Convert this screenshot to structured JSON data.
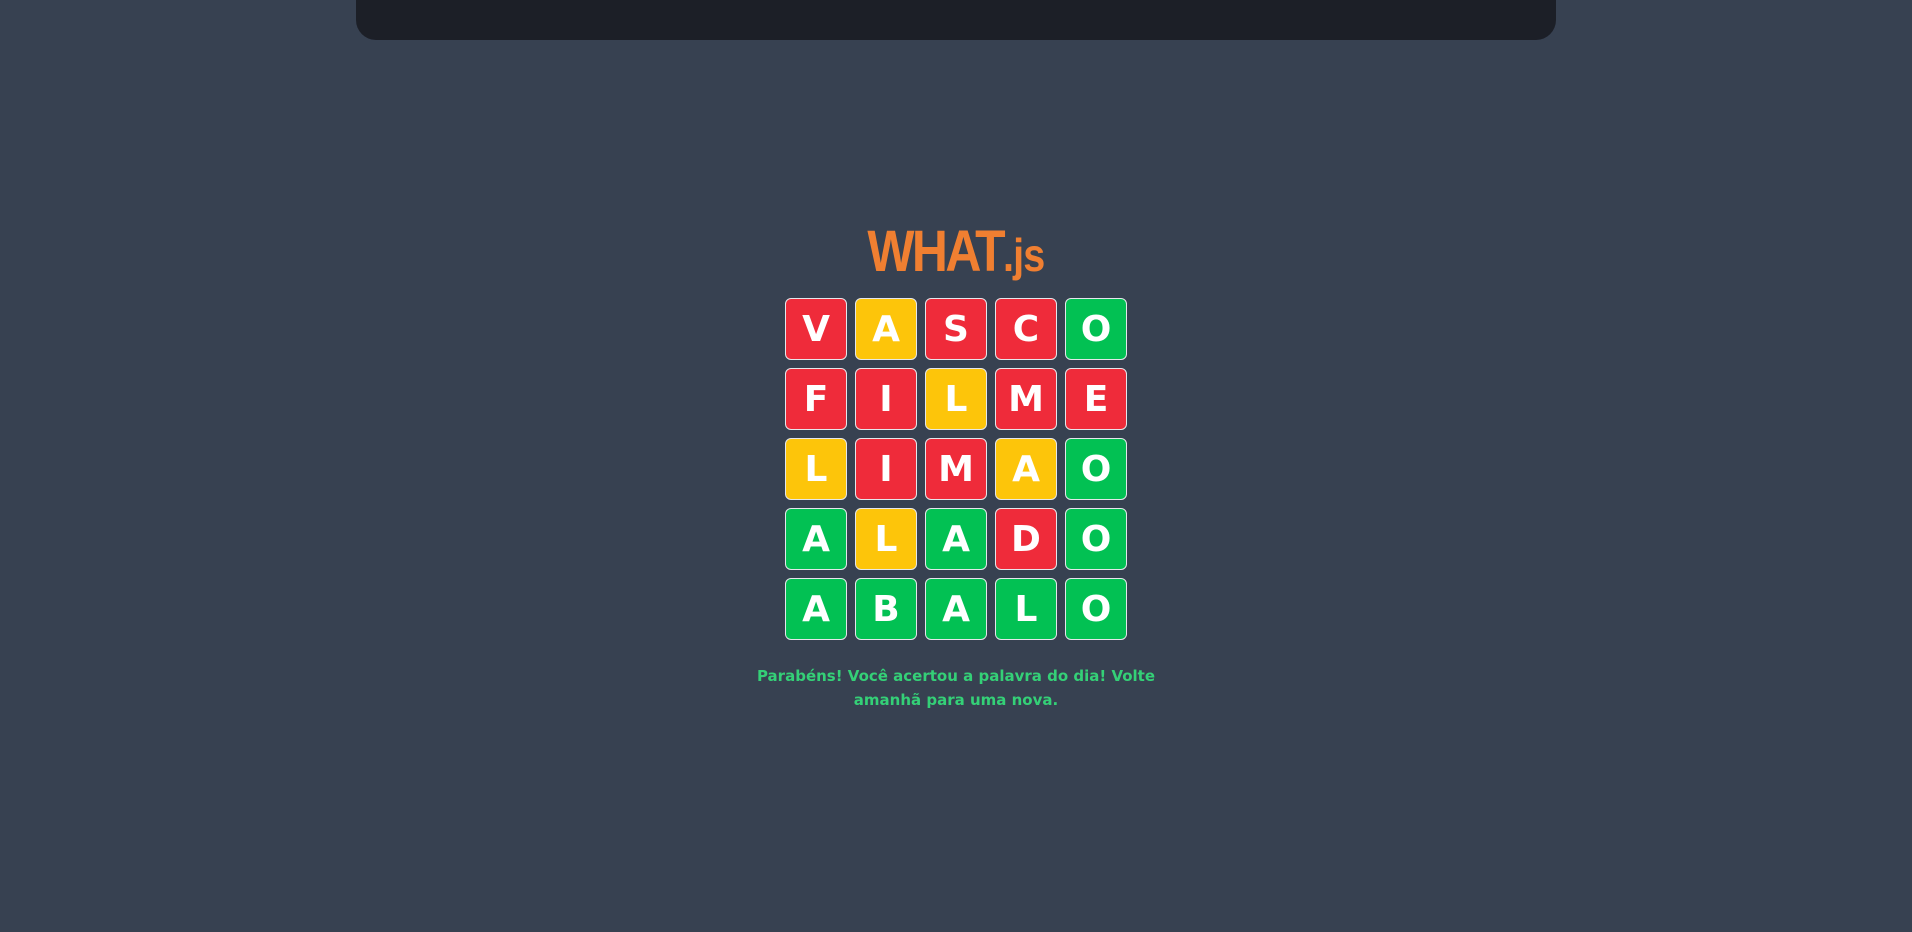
{
  "logo": {
    "main": "WHAT",
    "suffix": ".js",
    "color": "#f07f31"
  },
  "colors": {
    "background": "#374151",
    "top_bar": "#1c1f27",
    "wrong": "#ef2b3a",
    "present": "#fdc50a",
    "correct": "#02c153",
    "message": "#34d077"
  },
  "board": {
    "rows": [
      [
        {
          "letter": "V",
          "state": "wrong"
        },
        {
          "letter": "A",
          "state": "present"
        },
        {
          "letter": "S",
          "state": "wrong"
        },
        {
          "letter": "C",
          "state": "wrong"
        },
        {
          "letter": "O",
          "state": "correct"
        }
      ],
      [
        {
          "letter": "F",
          "state": "wrong"
        },
        {
          "letter": "I",
          "state": "wrong"
        },
        {
          "letter": "L",
          "state": "present"
        },
        {
          "letter": "M",
          "state": "wrong"
        },
        {
          "letter": "E",
          "state": "wrong"
        }
      ],
      [
        {
          "letter": "L",
          "state": "present"
        },
        {
          "letter": "I",
          "state": "wrong"
        },
        {
          "letter": "M",
          "state": "wrong"
        },
        {
          "letter": "A",
          "state": "present"
        },
        {
          "letter": "O",
          "state": "correct"
        }
      ],
      [
        {
          "letter": "A",
          "state": "correct"
        },
        {
          "letter": "L",
          "state": "present"
        },
        {
          "letter": "A",
          "state": "correct"
        },
        {
          "letter": "D",
          "state": "wrong"
        },
        {
          "letter": "O",
          "state": "correct"
        }
      ],
      [
        {
          "letter": "A",
          "state": "correct"
        },
        {
          "letter": "B",
          "state": "correct"
        },
        {
          "letter": "A",
          "state": "correct"
        },
        {
          "letter": "L",
          "state": "correct"
        },
        {
          "letter": "O",
          "state": "correct"
        }
      ]
    ]
  },
  "message": "Parabéns! Você acertou a palavra do dia! Volte amanhã para uma nova."
}
